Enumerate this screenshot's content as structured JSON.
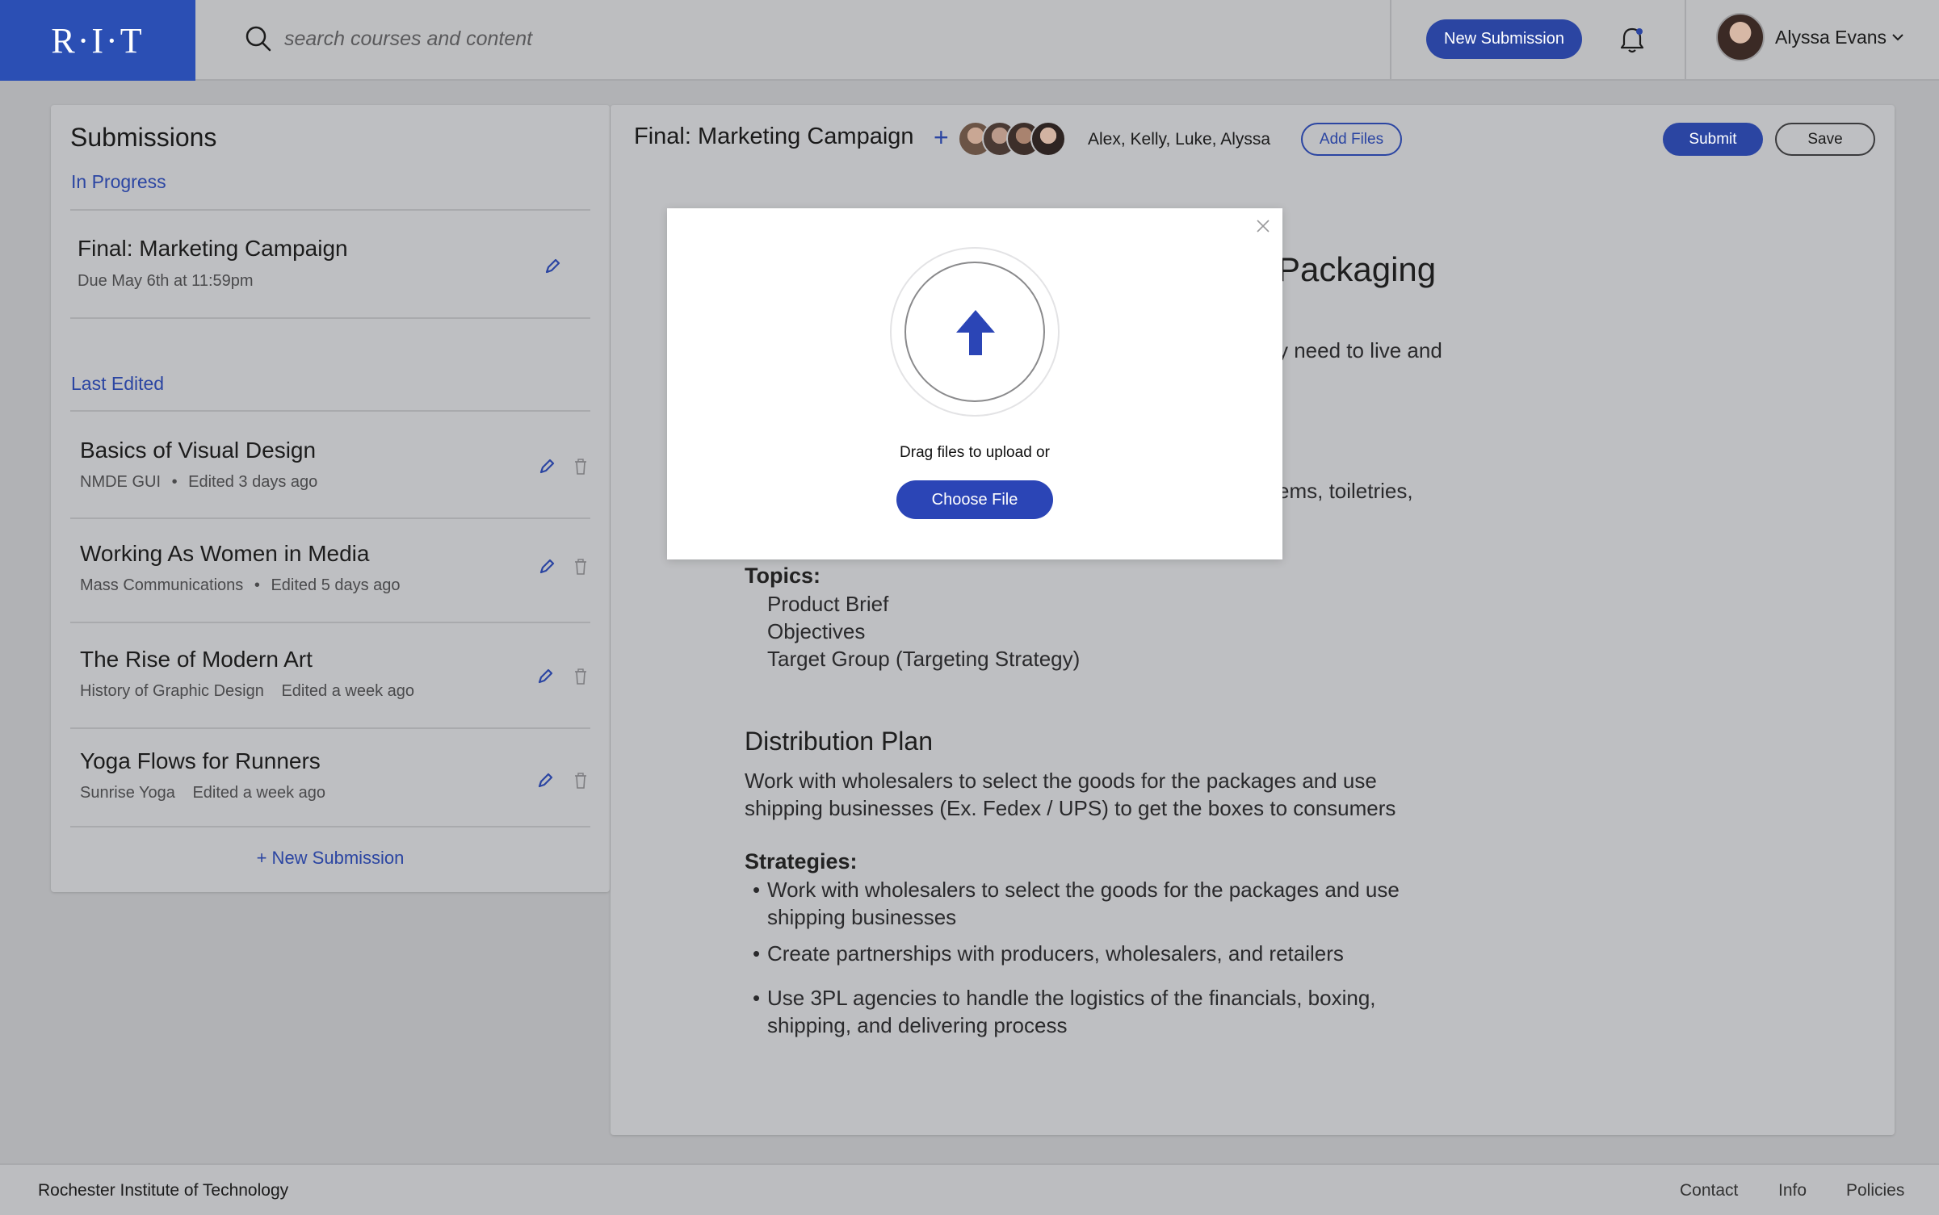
{
  "header": {
    "logo": "R·I·T",
    "search_placeholder": "search courses and content",
    "new_submission": "New Submission",
    "user_name": "Alyssa Evans"
  },
  "sidebar": {
    "title": "Submissions",
    "in_progress_label": "In Progress",
    "in_progress": [
      {
        "title": "Final: Marketing Campaign",
        "meta": "Due May 6th at 11:59pm"
      }
    ],
    "last_edited_label": "Last Edited",
    "last_edited": [
      {
        "title": "Basics of Visual Design",
        "course": "NMDE GUI",
        "edited": "Edited 3 days ago",
        "sep": "•"
      },
      {
        "title": "Working As Women in Media",
        "course": "Mass Communications",
        "edited": "Edited 5 days ago",
        "sep": "•"
      },
      {
        "title": "The Rise of Modern Art",
        "course": "History of Graphic Design",
        "edited": "Edited a week ago",
        "sep": ""
      },
      {
        "title": "Yoga Flows for Runners",
        "course": "Sunrise Yoga",
        "edited": "Edited a week ago",
        "sep": ""
      }
    ],
    "new_submission": "+ New Submission"
  },
  "main": {
    "title": "Final: Marketing Campaign",
    "plus": "+",
    "collaborators": "Alex, Kelly, Luke, Alyssa",
    "add_files": "Add Files",
    "submit": "Submit",
    "save": "Save",
    "doc": {
      "heading_partial": "Packaging",
      "line1_partial": "y need to live and",
      "line2_partial": "ems, toiletries,",
      "topics_label": "Topics:",
      "topics": [
        "Product Brief",
        "Objectives",
        "Target Group (Targeting Strategy)"
      ],
      "distribution_heading": "Distribution Plan",
      "distribution_text_1": "Work with wholesalers to select the goods for the packages and use",
      "distribution_text_2": "shipping businesses (Ex. Fedex / UPS)  to get the boxes to consumers",
      "strategies_label": "Strategies:",
      "strategies": [
        {
          "l1": "Work with wholesalers to select the goods for the packages and use",
          "l2": "shipping businesses"
        },
        {
          "l1": "Create partnerships with producers, wholesalers, and retailers",
          "l2": ""
        },
        {
          "l1": "Use 3PL agencies to handle the logistics of the financials, boxing,",
          "l2": "shipping, and delivering process"
        }
      ]
    }
  },
  "modal": {
    "drag_text": "Drag files to upload or",
    "choose_file": "Choose File"
  },
  "footer": {
    "org": "Rochester Institute of Technology",
    "links": [
      "Contact",
      "Info",
      "Policies"
    ]
  },
  "colors": {
    "accent": "#2b45a2",
    "logo_bg": "#2b4fb4",
    "overlay_bg": "#b1b2b5"
  }
}
